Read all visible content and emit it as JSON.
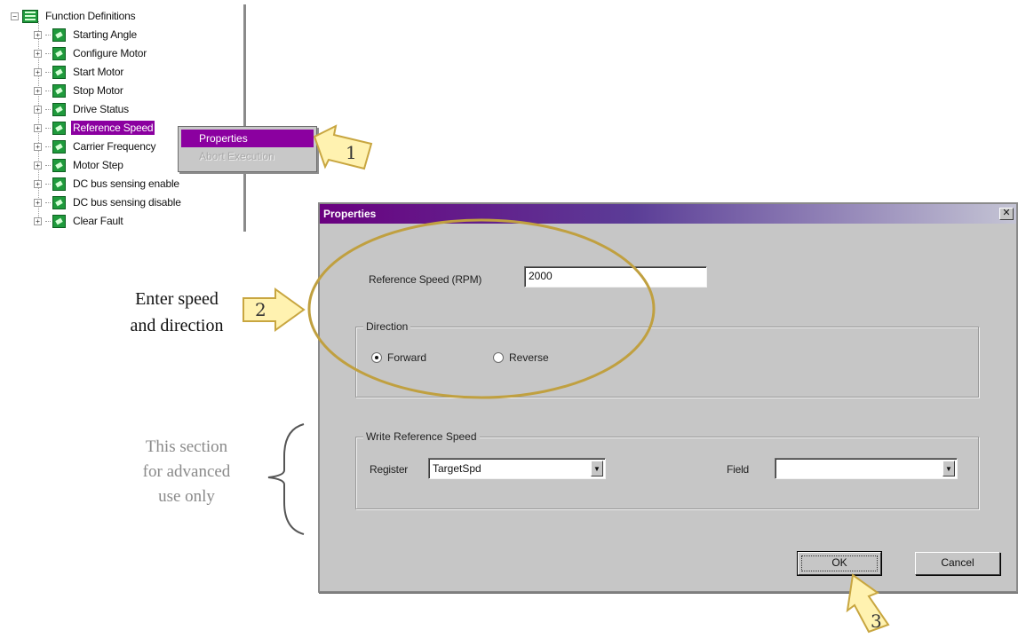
{
  "tree": {
    "root_label": "Function Definitions",
    "items": [
      {
        "label": "Starting Angle"
      },
      {
        "label": "Configure Motor"
      },
      {
        "label": "Start Motor"
      },
      {
        "label": "Stop Motor"
      },
      {
        "label": "Drive Status"
      },
      {
        "label": "Reference Speed",
        "selected": true
      },
      {
        "label": "Carrier Frequency"
      },
      {
        "label": "Motor Step"
      },
      {
        "label": "DC bus sensing enable"
      },
      {
        "label": "DC bus sensing disable"
      },
      {
        "label": "Clear Fault"
      }
    ]
  },
  "context_menu": {
    "properties_label": "Properties",
    "second_item_label": "Abort Execution"
  },
  "dialog": {
    "title": "Properties",
    "close_glyph": "✕",
    "speed_label": "Reference Speed (RPM)",
    "speed_value": "2000",
    "direction_group": "Direction",
    "forward_label": "Forward",
    "reverse_label": "Reverse",
    "forward_checked": true,
    "write_group": "Write Reference Speed",
    "register_label": "Register",
    "register_value": "TargetSpd",
    "field_label": "Field",
    "field_value": "",
    "ok_label": "OK",
    "cancel_label": "Cancel"
  },
  "annotations": {
    "step1": "1",
    "step2": "2",
    "step3": "3",
    "enter_line1": "Enter speed",
    "enter_line2": "and direction",
    "advanced_line1": "This section",
    "advanced_line2": "for advanced",
    "advanced_line3": "use only"
  },
  "colors": {
    "selection": "#8b00a0",
    "callout_fill": "#fff2b0",
    "callout_outline": "#c8a640",
    "ellipse": "#c0a040"
  }
}
